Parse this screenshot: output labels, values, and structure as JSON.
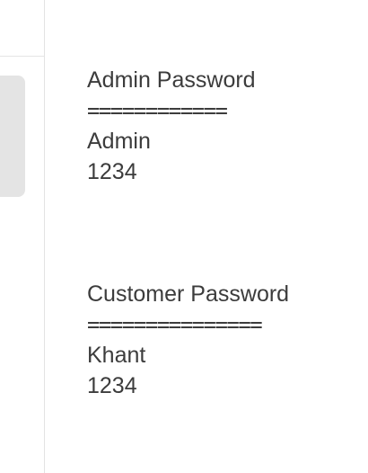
{
  "notes": [
    {
      "heading": "Admin Password",
      "separator": "============",
      "username": "Admin",
      "password": "1234"
    },
    {
      "heading": "Customer Password",
      "separator": "===============",
      "username": "Khant",
      "password": "1234"
    }
  ],
  "colors": {
    "text": "#3c3c3c",
    "selected_item": "#e4e4e4",
    "divider": "#e3e3e3"
  }
}
